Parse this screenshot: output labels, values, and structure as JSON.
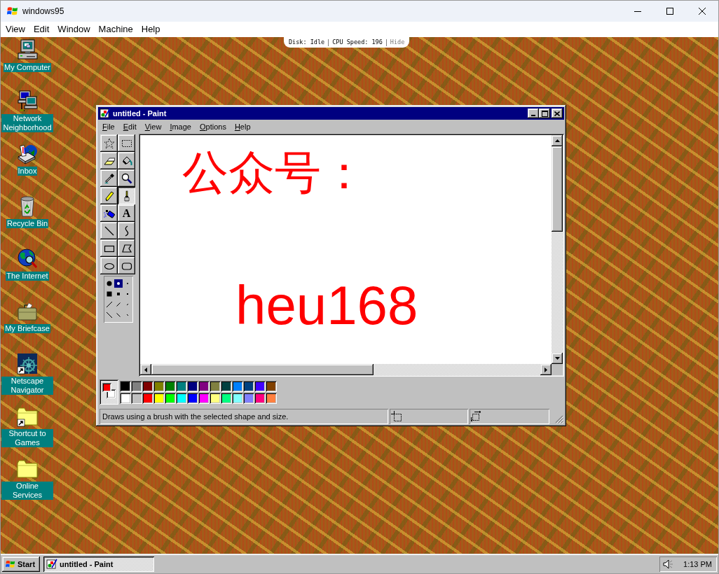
{
  "window": {
    "title": "windows95"
  },
  "menu_bar": [
    "View",
    "Edit",
    "Window",
    "Machine",
    "Help"
  ],
  "status_pill": [
    {
      "kind": "info",
      "text": "Disk: Idle"
    },
    {
      "kind": "info",
      "text": "CPU Speed: 196"
    },
    {
      "kind": "link",
      "text": "Hide"
    }
  ],
  "desktop_icons": [
    {
      "label": "My Computer"
    },
    {
      "label": "Network Neighborhood"
    },
    {
      "label": "Inbox"
    },
    {
      "label": "Recycle Bin"
    },
    {
      "label": "The Internet"
    },
    {
      "label": "My Briefcase"
    },
    {
      "label": "Netscape Navigator"
    },
    {
      "label": "Shortcut to Games"
    },
    {
      "label": "Online Services"
    }
  ],
  "paint": {
    "title": "untitled - Paint",
    "menu": [
      "File",
      "Edit",
      "View",
      "Image",
      "Options",
      "Help"
    ],
    "tools": [
      {
        "selected": false
      },
      {
        "selected": false
      },
      {
        "selected": false
      },
      {
        "selected": false
      },
      {
        "selected": false
      },
      {
        "selected": false
      },
      {
        "selected": false
      },
      {
        "selected": true
      },
      {
        "selected": false
      },
      {
        "selected": false,
        "glyph": "A"
      },
      {
        "selected": false
      },
      {
        "selected": false
      },
      {
        "selected": false
      },
      {
        "selected": false
      },
      {
        "selected": false
      },
      {
        "selected": false
      }
    ],
    "brush_shapes": [
      {
        "selected": false
      },
      {
        "selected": true
      },
      {
        "selected": false
      },
      {
        "selected": false
      },
      {
        "selected": false
      },
      {
        "selected": false
      },
      {
        "selected": false
      },
      {
        "selected": false
      },
      {
        "selected": false
      },
      {
        "selected": false
      },
      {
        "selected": false
      },
      {
        "selected": false
      }
    ],
    "canvas": {
      "lines": [
        "公众号：",
        "heu168"
      ]
    },
    "palette": {
      "foreground": {
        "color": "#ff0000"
      },
      "background": {
        "color": "#ffffff"
      },
      "colors": [
        {
          "color": "#000000"
        },
        {
          "color": "#808080"
        },
        {
          "color": "#800000"
        },
        {
          "color": "#808000"
        },
        {
          "color": "#008000"
        },
        {
          "color": "#008080"
        },
        {
          "color": "#000080"
        },
        {
          "color": "#800080"
        },
        {
          "color": "#808040"
        },
        {
          "color": "#004040"
        },
        {
          "color": "#0080ff"
        },
        {
          "color": "#004080"
        },
        {
          "color": "#4000ff"
        },
        {
          "color": "#804000"
        },
        {
          "color": "#ffffff"
        },
        {
          "color": "#c0c0c0"
        },
        {
          "color": "#ff0000"
        },
        {
          "color": "#ffff00"
        },
        {
          "color": "#00ff00"
        },
        {
          "color": "#00ffff"
        },
        {
          "color": "#0000ff"
        },
        {
          "color": "#ff00ff"
        },
        {
          "color": "#ffff80"
        },
        {
          "color": "#00ff80"
        },
        {
          "color": "#80ffff"
        },
        {
          "color": "#8080ff"
        },
        {
          "color": "#ff0080"
        },
        {
          "color": "#ff8040"
        }
      ]
    },
    "status_text": "Draws using a brush with the selected shape and size."
  },
  "taskbar": {
    "start": "Start",
    "tasks": [
      {
        "label": "untitled - Paint",
        "selected": true
      }
    ],
    "clock": "1:13 PM"
  }
}
